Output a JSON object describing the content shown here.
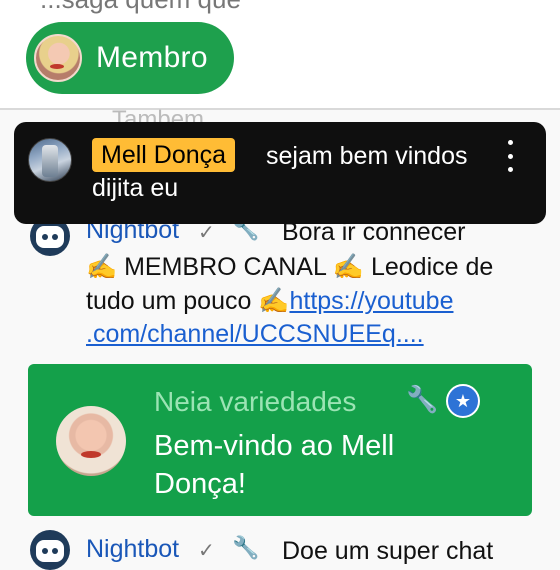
{
  "header": {
    "cut_text": "...saga quem que",
    "member_pill_label": "Membro"
  },
  "chat": {
    "faded_message": "Tambem",
    "pinned": {
      "author": "Mell Donça",
      "message": "sejam bem vindos",
      "message_line2": "dijita eu"
    },
    "message1": {
      "author": "Nightbot",
      "text": "Bora ir connecer",
      "line2": "✍️ MEMBRO CANAL ✍️ Leodice de",
      "line3_prefix": "tudo um pouco ✍️",
      "link_part1": "https://youtube",
      "link_part2": ".com/channel/UCCSNUEEq....",
      "line4_suffix": ""
    },
    "welcome_card": {
      "name": "Neia variedades",
      "message_line1": "Bem-vindo ao Mell",
      "message_line2": "Donça!"
    },
    "message2": {
      "author": "Nightbot",
      "text": "Doe um super chat"
    }
  },
  "colors": {
    "member_green": "#1ea04d",
    "welcome_green": "#14a04a",
    "author_chip": "#ffbc35",
    "link_blue": "#1a5fd0"
  }
}
